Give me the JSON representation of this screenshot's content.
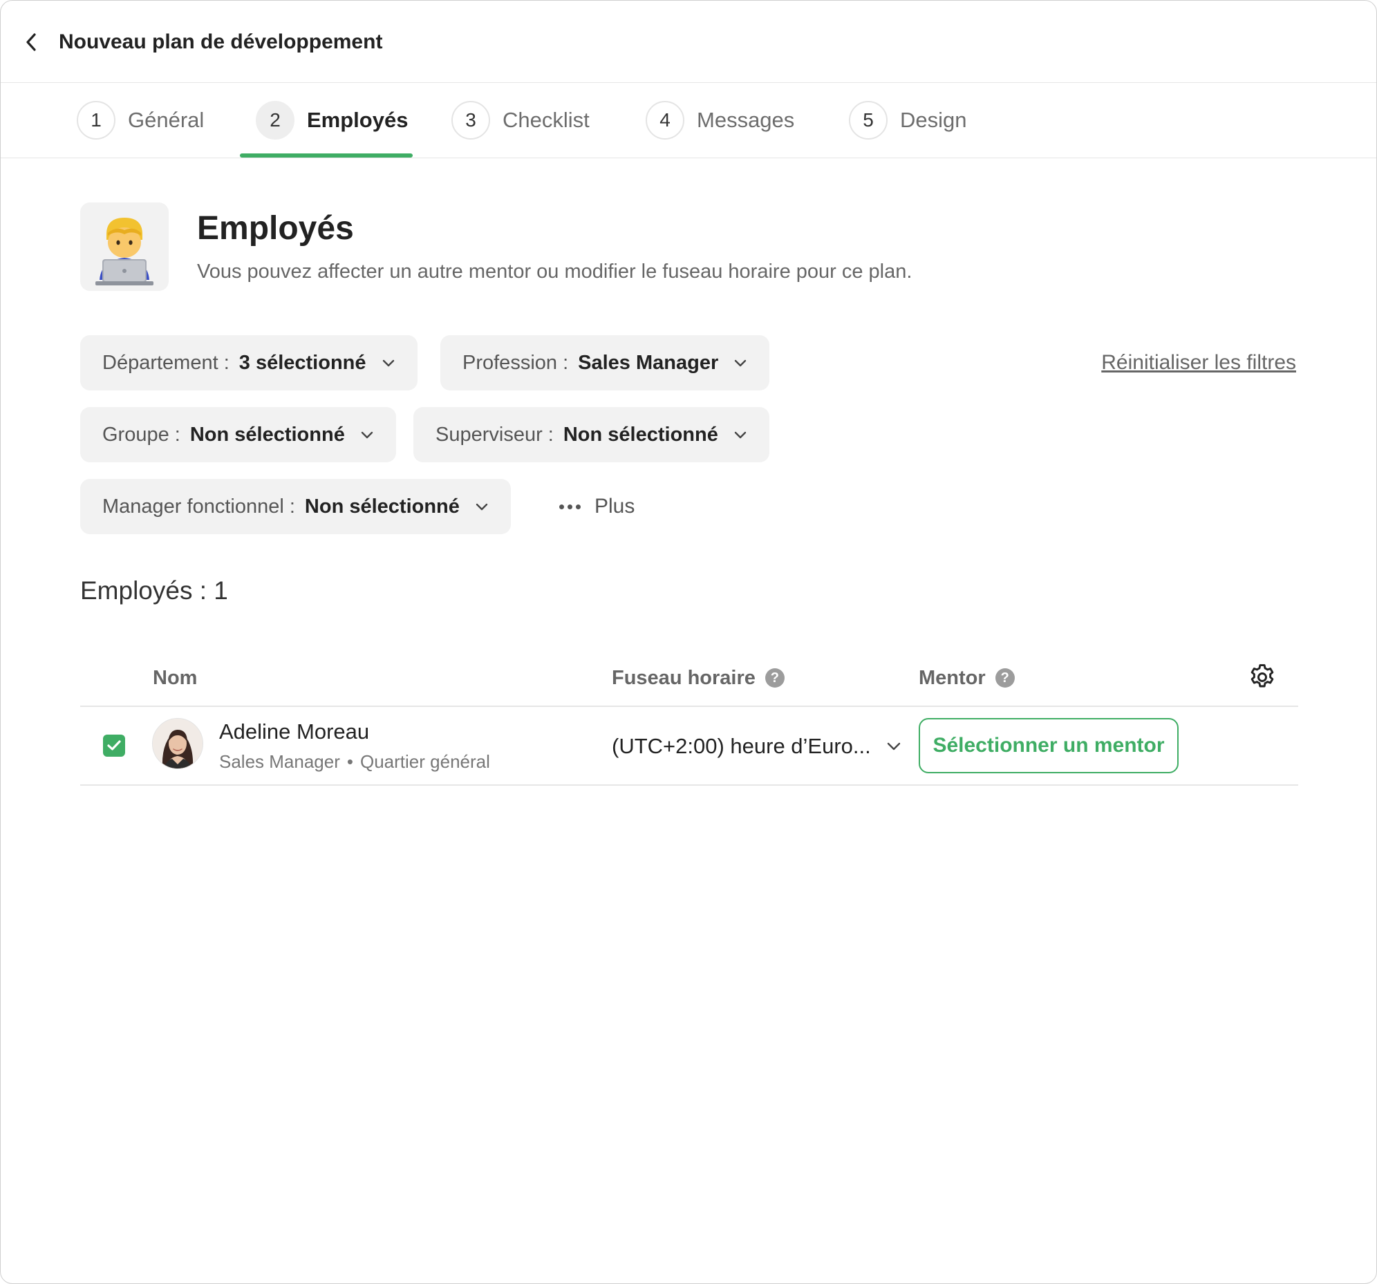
{
  "header": {
    "title": "Nouveau plan de développement"
  },
  "steps": [
    {
      "number": "1",
      "label": "Général"
    },
    {
      "number": "2",
      "label": "Employés",
      "active": true
    },
    {
      "number": "3",
      "label": "Checklist"
    },
    {
      "number": "4",
      "label": "Messages"
    },
    {
      "number": "5",
      "label": "Design"
    }
  ],
  "intro": {
    "icon": "technologist-emoji-icon",
    "title": "Employés",
    "description": "Vous pouvez affecter un autre mentor ou modifier le fuseau horaire pour ce plan."
  },
  "filters": {
    "department": {
      "label": "Département :",
      "value": "3 sélectionné"
    },
    "profession": {
      "label": "Profession :",
      "value": "Sales Manager"
    },
    "group": {
      "label": "Groupe :",
      "value": "Non sélectionné"
    },
    "supervisor": {
      "label": "Superviseur :",
      "value": "Non sélectionné"
    },
    "functional_manager": {
      "label": "Manager fonctionnel :",
      "value": "Non sélectionné"
    },
    "more_label": "Plus",
    "reset_label": "Réinitialiser les filtres"
  },
  "employees_count": "Employés : 1",
  "table": {
    "columns": {
      "name": "Nom",
      "timezone": "Fuseau horaire",
      "mentor": "Mentor"
    },
    "rows": [
      {
        "checked": true,
        "name": "Adeline Moreau",
        "position": "Sales Manager",
        "separator": "•",
        "location": "Quartier général",
        "timezone": "(UTC+2:00) heure d’Euro...",
        "mentor_button": "Sélectionner un mentor"
      }
    ]
  },
  "colors": {
    "accent": "#3fad64",
    "chip_bg": "#f2f2f2",
    "divider": "#e6e6e6"
  }
}
